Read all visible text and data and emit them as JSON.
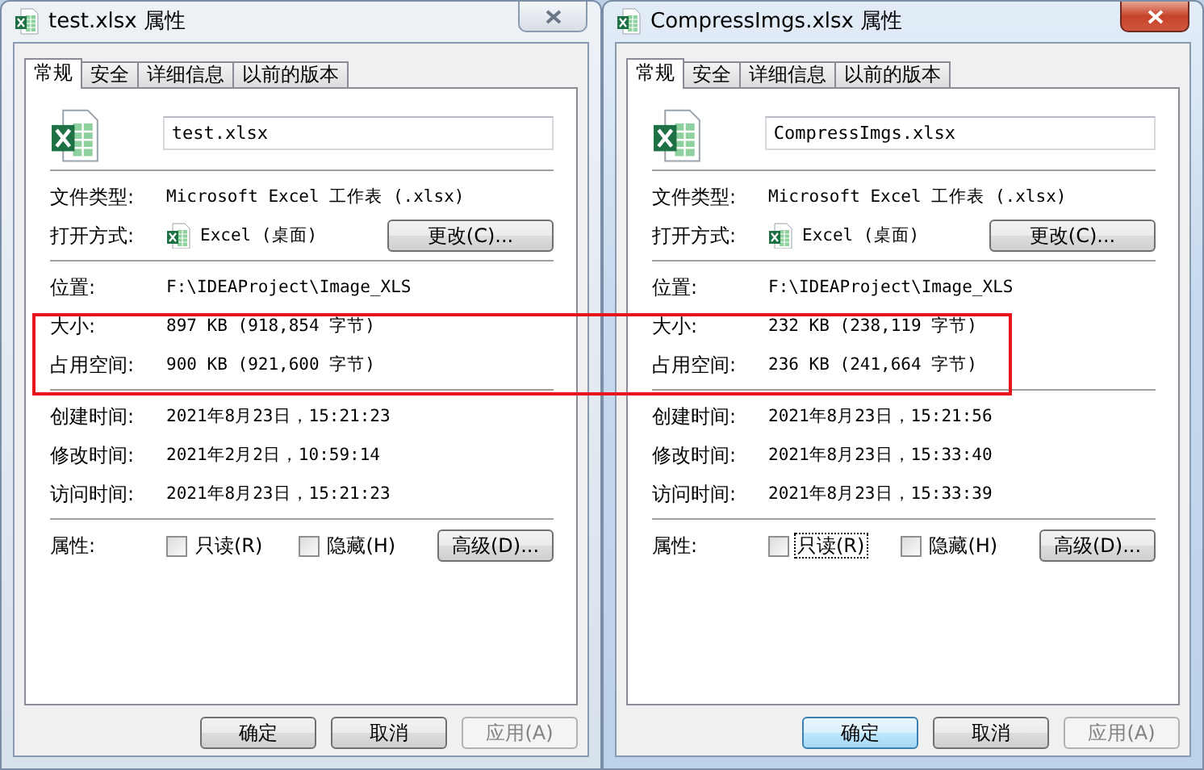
{
  "dialogs": [
    {
      "title": "test.xlsx 属性",
      "active": false,
      "tabs": [
        {
          "label": "常规",
          "selected": true
        },
        {
          "label": "安全",
          "selected": false
        },
        {
          "label": "详细信息",
          "selected": false
        },
        {
          "label": "以前的版本",
          "selected": false
        }
      ],
      "filename": "test.xlsx",
      "sections": [
        [
          {
            "kind": "text",
            "label": "文件类型:",
            "value": "Microsoft Excel 工作表 (.xlsx)"
          },
          {
            "kind": "app",
            "label": "打开方式:",
            "value": "Excel (桌面)",
            "button": "更改(C)..."
          }
        ],
        [
          {
            "kind": "text",
            "label": "位置:",
            "value": "F:\\IDEAProject\\Image_XLS"
          },
          {
            "kind": "text",
            "label": "大小:",
            "value": "897 KB (918,854 字节)"
          },
          {
            "kind": "text",
            "label": "占用空间:",
            "value": "900 KB (921,600 字节)"
          }
        ],
        [
          {
            "kind": "text",
            "label": "创建时间:",
            "value": "2021年8月23日，15:21:23"
          },
          {
            "kind": "text",
            "label": "修改时间:",
            "value": "2021年2月2日，10:59:14"
          },
          {
            "kind": "text",
            "label": "访问时间:",
            "value": "2021年8月23日，15:21:23"
          }
        ]
      ],
      "attributes_label": "属性:",
      "attributes": [
        {
          "label": "只读(R)",
          "checked": false,
          "focused": false
        },
        {
          "label": "隐藏(H)",
          "checked": false,
          "focused": false
        }
      ],
      "advanced_button": "高级(D)...",
      "buttons": [
        {
          "label": "确定",
          "disabled": false,
          "default": false
        },
        {
          "label": "取消",
          "disabled": false,
          "default": false
        },
        {
          "label": "应用(A)",
          "disabled": true,
          "default": false
        }
      ]
    },
    {
      "title": "CompressImgs.xlsx 属性",
      "active": true,
      "tabs": [
        {
          "label": "常规",
          "selected": true
        },
        {
          "label": "安全",
          "selected": false
        },
        {
          "label": "详细信息",
          "selected": false
        },
        {
          "label": "以前的版本",
          "selected": false
        }
      ],
      "filename": "CompressImgs.xlsx",
      "sections": [
        [
          {
            "kind": "text",
            "label": "文件类型:",
            "value": "Microsoft Excel 工作表 (.xlsx)"
          },
          {
            "kind": "app",
            "label": "打开方式:",
            "value": "Excel (桌面)",
            "button": "更改(C)..."
          }
        ],
        [
          {
            "kind": "text",
            "label": "位置:",
            "value": "F:\\IDEAProject\\Image_XLS"
          },
          {
            "kind": "text",
            "label": "大小:",
            "value": "232 KB (238,119 字节)"
          },
          {
            "kind": "text",
            "label": "占用空间:",
            "value": "236 KB (241,664 字节)"
          }
        ],
        [
          {
            "kind": "text",
            "label": "创建时间:",
            "value": "2021年8月23日，15:21:56"
          },
          {
            "kind": "text",
            "label": "修改时间:",
            "value": "2021年8月23日，15:33:40"
          },
          {
            "kind": "text",
            "label": "访问时间:",
            "value": "2021年8月23日，15:33:39"
          }
        ]
      ],
      "attributes_label": "属性:",
      "attributes": [
        {
          "label": "只读(R)",
          "checked": false,
          "focused": true
        },
        {
          "label": "隐藏(H)",
          "checked": false,
          "focused": false
        }
      ],
      "advanced_button": "高级(D)...",
      "buttons": [
        {
          "label": "确定",
          "disabled": false,
          "default": true
        },
        {
          "label": "取消",
          "disabled": false,
          "default": false
        },
        {
          "label": "应用(A)",
          "disabled": true,
          "default": false
        }
      ]
    }
  ]
}
